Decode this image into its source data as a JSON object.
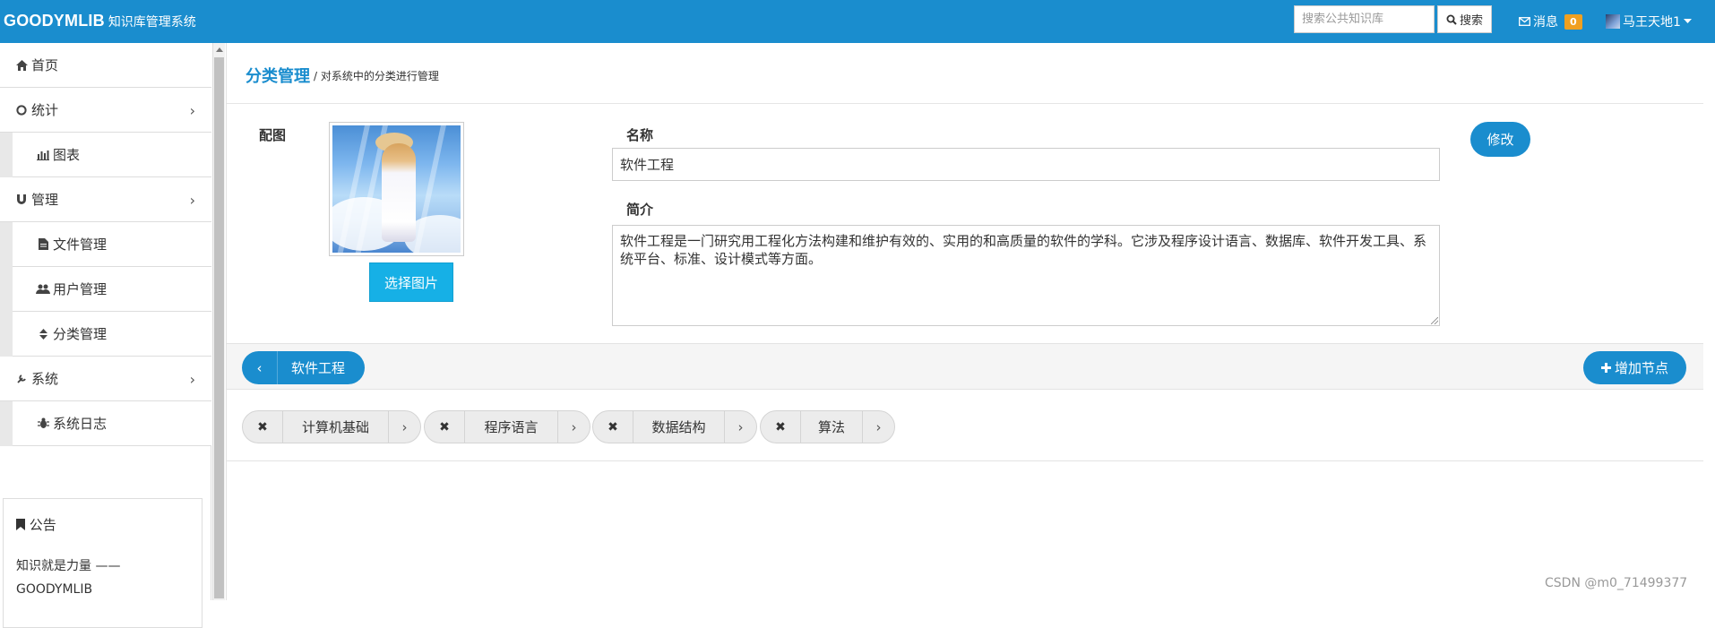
{
  "navbar": {
    "brand": "GOODYMLIB",
    "brand_sub": "知识库管理系统",
    "search_placeholder": "搜索公共知识库",
    "search_button": "搜索",
    "messages_label": "消息",
    "messages_count": "0",
    "user_name": "马王天地1"
  },
  "sidebar": {
    "items": [
      {
        "label": "首页",
        "icon": "home-icon"
      },
      {
        "label": "统计",
        "icon": "circle-icon"
      },
      {
        "label": "图表",
        "icon": "bar-chart-icon"
      },
      {
        "label": "管理",
        "icon": "magnet-icon"
      },
      {
        "label": "文件管理",
        "icon": "file-icon"
      },
      {
        "label": "用户管理",
        "icon": "users-icon"
      },
      {
        "label": "分类管理",
        "icon": "sort-icon"
      },
      {
        "label": "系统",
        "icon": "wrench-icon"
      },
      {
        "label": "系统日志",
        "icon": "bug-icon"
      }
    ],
    "notice": {
      "title": "公告",
      "body": "知识就是力量 —— GOODYMLIB"
    }
  },
  "page": {
    "title": "分类管理",
    "subtitle": "/ 对系统中的分类进行管理"
  },
  "form": {
    "image_label": "配图",
    "choose_image_button": "选择图片",
    "name_label": "名称",
    "name_value": "软件工程",
    "intro_label": "简介",
    "intro_value": "软件工程是一门研究用工程化方法构建和维护有效的、实用的和高质量的软件的学科。它涉及程序设计语言、数据库、软件开发工具、系统平台、标准、设计模式等方面。",
    "edit_button": "修改"
  },
  "tree": {
    "current": "软件工程",
    "add_button": "增加节点",
    "children": [
      "计算机基础",
      "程序语言",
      "数据结构",
      "算法"
    ]
  },
  "watermark": "CSDN @m0_71499377",
  "colors": {
    "primary": "#1a8dce",
    "pick_button": "#16b0e6",
    "badge": "#f0a020"
  }
}
